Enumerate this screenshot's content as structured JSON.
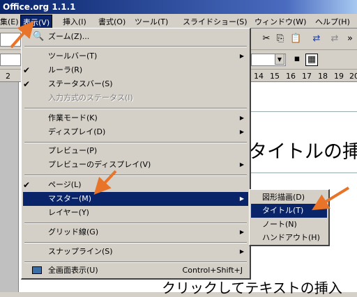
{
  "window": {
    "title": "Office.org 1.1.1"
  },
  "menubar": {
    "items": [
      "集(E)",
      "表示(V)",
      "挿入(I)",
      "書式(O)",
      "ツール(T)",
      "スライドショー(S)",
      "ウィンドウ(W)",
      "ヘルプ(H)"
    ]
  },
  "ruler": {
    "ticks": [
      "2",
      "14",
      "15",
      "16",
      "17",
      "18",
      "19",
      "20"
    ]
  },
  "slide": {
    "title_text": "タイトルの挿",
    "body_text": "クリックしてテキストの挿入"
  },
  "view_menu": {
    "zoom": "ズーム(Z)...",
    "toolbars": "ツールバー(T)",
    "ruler": "ルーラ(R)",
    "statusbar": "ステータスバー(S)",
    "input_status": "入力方式のステータス(I)",
    "work_mode": "作業モード(K)",
    "display": "ディスプレイ(D)",
    "preview": "プレビュー(P)",
    "preview_display": "プレビューのディスプレイ(V)",
    "page": "ページ(L)",
    "master": "マスター(M)",
    "layer": "レイヤー(Y)",
    "grid": "グリッド線(G)",
    "snaplines": "スナップライン(S)",
    "fullscreen": "全画面表示(U)",
    "fullscreen_accel": "Control+Shift+J"
  },
  "master_submenu": {
    "drawing": "図形描画(D)",
    "title": "タイトル(T)",
    "notes": "ノート(N)",
    "handout": "ハンドアウト(H)"
  },
  "colors": {
    "selection": "#0a246a",
    "menu_bg": "#d4d0c8",
    "pointer": "#e8742a"
  }
}
